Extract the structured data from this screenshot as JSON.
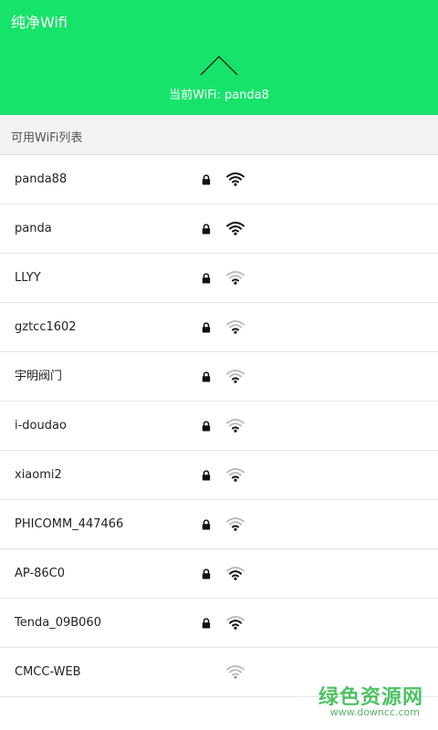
{
  "header": {
    "title": "纯净Wifi",
    "current_wifi_label": "当前WiFi: ",
    "current_wifi_name": "panda8",
    "background_color": "#17e36a"
  },
  "section": {
    "title": "可用WiFi列表"
  },
  "networks": [
    {
      "name": "panda88",
      "locked": true,
      "signal": "strong"
    },
    {
      "name": "panda",
      "locked": true,
      "signal": "strong"
    },
    {
      "name": "LLYY",
      "locked": true,
      "signal": "weak"
    },
    {
      "name": "gztcc1602",
      "locked": true,
      "signal": "weak"
    },
    {
      "name": "宇明阀门",
      "locked": true,
      "signal": "weak"
    },
    {
      "name": "i-doudao",
      "locked": true,
      "signal": "weak"
    },
    {
      "name": "xiaomi2",
      "locked": true,
      "signal": "weak"
    },
    {
      "name": "PHICOMM_447466",
      "locked": true,
      "signal": "weak"
    },
    {
      "name": "AP-86C0",
      "locked": true,
      "signal": "medium"
    },
    {
      "name": "Tenda_09B060",
      "locked": true,
      "signal": "medium"
    },
    {
      "name": "CMCC-WEB",
      "locked": false,
      "signal": "faint"
    }
  ],
  "icons": {
    "expand": "chevron-up-icon",
    "lock": "lock-icon",
    "signal": "wifi-signal-icon"
  },
  "watermark": {
    "text": "绿色资源网",
    "url": "www.downcc.com"
  }
}
